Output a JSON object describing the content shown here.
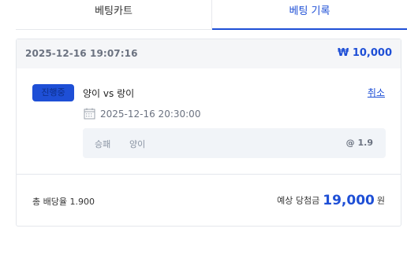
{
  "tabs": [
    {
      "label": "베팅카트",
      "active": false
    },
    {
      "label": "베팅 기록",
      "active": true
    }
  ],
  "bet": {
    "placed_at": "2025-12-16 19:07:16",
    "stake": "₩ 10,000",
    "status": "진행중",
    "match": "양이 vs 랑이",
    "cancel_label": "취소",
    "game_time": "2025-12-16 20:30:00",
    "pick": {
      "market": "승패",
      "selection": "양이",
      "odds": "@ 1.9"
    },
    "total_odds": "총 배당율 1.900",
    "payout_label": "예상 당첨금",
    "payout_amount": "19,000",
    "payout_unit": "원"
  },
  "colors": {
    "accent": "#1e4fd6",
    "header_bg": "#f5f6f8",
    "pick_bg": "#f1f4f8",
    "border": "#e4e7ec"
  },
  "icons": {
    "game_time": "calendar-icon"
  }
}
